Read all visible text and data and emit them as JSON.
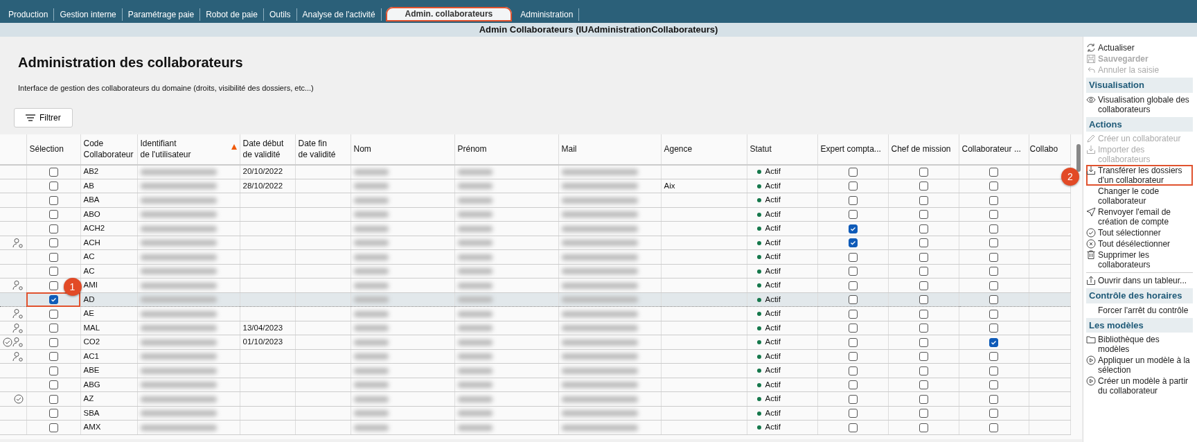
{
  "menu_tabs": [
    {
      "label": "Production",
      "selected": false,
      "highlighted": false
    },
    {
      "label": "Gestion interne",
      "selected": false,
      "highlighted": false
    },
    {
      "label": "Paramétrage paie",
      "selected": false,
      "highlighted": false
    },
    {
      "label": "Robot de paie",
      "selected": false,
      "highlighted": false
    },
    {
      "label": "Outils",
      "selected": false,
      "highlighted": false
    },
    {
      "label": "Analyse de l'activité",
      "selected": false,
      "highlighted": false
    },
    {
      "label": "Admin. collaborateurs",
      "selected": true,
      "highlighted": true
    },
    {
      "label": "Administration",
      "selected": false,
      "highlighted": false
    }
  ],
  "window": {
    "title": "Admin Collaborateurs (IUAdministrationCollaborateurs)"
  },
  "page": {
    "heading": "Administration des collaborateurs",
    "description": "Interface de gestion des collaborateurs du domaine (droits, visibilité des dossiers, etc...)",
    "filter_button": "Filtrer"
  },
  "table": {
    "columns": [
      {
        "label": "Sélection",
        "sorted": false
      },
      {
        "label": "Code\nCollaborateur",
        "sorted": false
      },
      {
        "label": "Identifiant\nde l'utilisateur",
        "sorted": true
      },
      {
        "label": "Date début\nde validité",
        "sorted": false
      },
      {
        "label": "Date fin\nde validité",
        "sorted": false
      },
      {
        "label": "Nom",
        "sorted": false
      },
      {
        "label": "Prénom",
        "sorted": false
      },
      {
        "label": "Mail",
        "sorted": false
      },
      {
        "label": "Agence",
        "sorted": false
      },
      {
        "label": "Statut",
        "sorted": false
      },
      {
        "label": "Expert compta...",
        "sorted": false
      },
      {
        "label": "Chef de mission",
        "sorted": false
      },
      {
        "label": "Collaborateur ...",
        "sorted": false
      },
      {
        "label": "Collabo",
        "sorted": false
      }
    ],
    "rows": [
      {
        "selected": false,
        "user_badge": false,
        "verified": false,
        "checked": false,
        "code": "AB2",
        "redacted": true,
        "start": "20/10/2022",
        "status": "Actif",
        "expert": false,
        "chef": false,
        "collab": false
      },
      {
        "selected": false,
        "user_badge": false,
        "verified": false,
        "checked": false,
        "code": "AB",
        "redacted": true,
        "start": "28/10/2022",
        "agency": "Aix",
        "status": "Actif",
        "expert": false,
        "chef": false,
        "collab": false
      },
      {
        "selected": false,
        "user_badge": false,
        "verified": false,
        "checked": false,
        "code": "ABA",
        "redacted": true,
        "status": "Actif",
        "expert": false,
        "chef": false,
        "collab": false
      },
      {
        "selected": false,
        "user_badge": false,
        "verified": false,
        "checked": false,
        "code": "ABO",
        "redacted": true,
        "status": "Actif",
        "expert": false,
        "chef": false,
        "collab": false
      },
      {
        "selected": false,
        "user_badge": false,
        "verified": false,
        "checked": false,
        "code": "ACH2",
        "redacted": true,
        "status": "Actif",
        "expert": true,
        "chef": false,
        "collab": false
      },
      {
        "selected": false,
        "user_badge": true,
        "verified": false,
        "checked": false,
        "code": "ACH",
        "redacted": true,
        "status": "Actif",
        "expert": true,
        "chef": false,
        "collab": false
      },
      {
        "selected": false,
        "user_badge": false,
        "verified": false,
        "checked": false,
        "code": "AC",
        "redacted": true,
        "status": "Actif",
        "expert": false,
        "chef": false,
        "collab": false
      },
      {
        "selected": false,
        "user_badge": false,
        "verified": false,
        "checked": false,
        "code": "AC",
        "redacted": true,
        "status": "Actif",
        "expert": false,
        "chef": false,
        "collab": false
      },
      {
        "selected": false,
        "user_badge": true,
        "verified": false,
        "checked": false,
        "code": "AMI",
        "redacted": true,
        "status": "Actif",
        "expert": false,
        "chef": false,
        "collab": false
      },
      {
        "selected": true,
        "user_badge": false,
        "verified": false,
        "checked": true,
        "code": "AD",
        "redacted": true,
        "status": "Actif",
        "expert": false,
        "chef": false,
        "collab": false,
        "annotation": "1"
      },
      {
        "selected": false,
        "user_badge": true,
        "verified": false,
        "checked": false,
        "code": "AE",
        "redacted": true,
        "status": "Actif",
        "expert": false,
        "chef": false,
        "collab": false
      },
      {
        "selected": false,
        "user_badge": true,
        "verified": false,
        "checked": false,
        "code": "MAL",
        "redacted": true,
        "start": "13/04/2023",
        "status": "Actif",
        "expert": false,
        "chef": false,
        "collab": false
      },
      {
        "selected": false,
        "user_badge": true,
        "verified": true,
        "checked": false,
        "code": "CO2",
        "redacted": true,
        "start": "01/10/2023",
        "status": "Actif",
        "expert": false,
        "chef": false,
        "collab": true
      },
      {
        "selected": false,
        "user_badge": true,
        "verified": false,
        "checked": false,
        "code": "AC1",
        "redacted": true,
        "status": "Actif",
        "expert": false,
        "chef": false,
        "collab": false
      },
      {
        "selected": false,
        "user_badge": false,
        "verified": false,
        "checked": false,
        "code": "ABE",
        "redacted": true,
        "status": "Actif",
        "expert": false,
        "chef": false,
        "collab": false
      },
      {
        "selected": false,
        "user_badge": false,
        "verified": false,
        "checked": false,
        "code": "ABG",
        "redacted": true,
        "status": "Actif",
        "expert": false,
        "chef": false,
        "collab": false
      },
      {
        "selected": false,
        "user_badge": false,
        "verified": true,
        "checked": false,
        "code": "AZ",
        "redacted": true,
        "status": "Actif",
        "expert": false,
        "chef": false,
        "collab": false
      },
      {
        "selected": false,
        "user_badge": false,
        "verified": false,
        "checked": false,
        "code": "SBA",
        "redacted": true,
        "status": "Actif",
        "expert": false,
        "chef": false,
        "collab": false
      },
      {
        "selected": false,
        "user_badge": false,
        "verified": false,
        "checked": false,
        "code": "AMX",
        "redacted": true,
        "status": "Actif",
        "expert": false,
        "chef": false,
        "collab": false
      }
    ]
  },
  "sidebar": {
    "sections": [
      {
        "items": [
          {
            "label": "Actualiser",
            "kind": "refresh",
            "disabled": false,
            "bold": false
          },
          {
            "label": "Sauvegarder",
            "kind": "save",
            "disabled": true,
            "bold": true
          },
          {
            "label": "Annuler la saisie",
            "kind": "undo",
            "disabled": true,
            "bold": false
          }
        ]
      },
      {
        "title": "Visualisation",
        "items": [
          {
            "label": "Visualisation globale des collaborateurs",
            "kind": "view",
            "disabled": false,
            "bold": false
          }
        ]
      },
      {
        "title": "Actions",
        "items": [
          {
            "label": "Créer un collaborateur",
            "kind": "edit",
            "disabled": true,
            "bold": false
          },
          {
            "label": "Importer des collaborateurs",
            "kind": "import",
            "disabled": true,
            "bold": false
          },
          {
            "label": "Transférer les dossiers d'un collaborateur",
            "kind": "import",
            "disabled": false,
            "bold": false,
            "annotation": "2"
          },
          {
            "label": "Changer le code collaborateur",
            "kind": "plain",
            "disabled": false,
            "bold": false
          },
          {
            "label": "Renvoyer l'email de création de compte",
            "kind": "send",
            "disabled": false,
            "bold": false
          },
          {
            "label": "Tout sélectionner",
            "kind": "check",
            "disabled": false,
            "bold": false
          },
          {
            "label": "Tout désélectionner",
            "kind": "clear",
            "disabled": false,
            "bold": false
          },
          {
            "label": "Supprimer les collaborateurs",
            "kind": "delete",
            "disabled": false,
            "bold": false
          },
          {
            "label": "Ouvrir dans un tableur...",
            "kind": "export",
            "disabled": false,
            "bold": false
          }
        ]
      },
      {
        "title": "Contrôle des horaires",
        "items": [
          {
            "label": "Forcer l'arrêt du contrôle",
            "kind": "plain",
            "disabled": false,
            "bold": false
          }
        ]
      },
      {
        "title": "Les modèles",
        "items": [
          {
            "label": "Bibliothèque des modèles",
            "kind": "folder",
            "disabled": false,
            "bold": false
          },
          {
            "label": "Appliquer un modèle à la sélection",
            "kind": "play",
            "disabled": false,
            "bold": false
          },
          {
            "label": "Créer un modèle à partir du collaborateur",
            "kind": "play",
            "disabled": false,
            "bold": false
          }
        ]
      }
    ]
  }
}
